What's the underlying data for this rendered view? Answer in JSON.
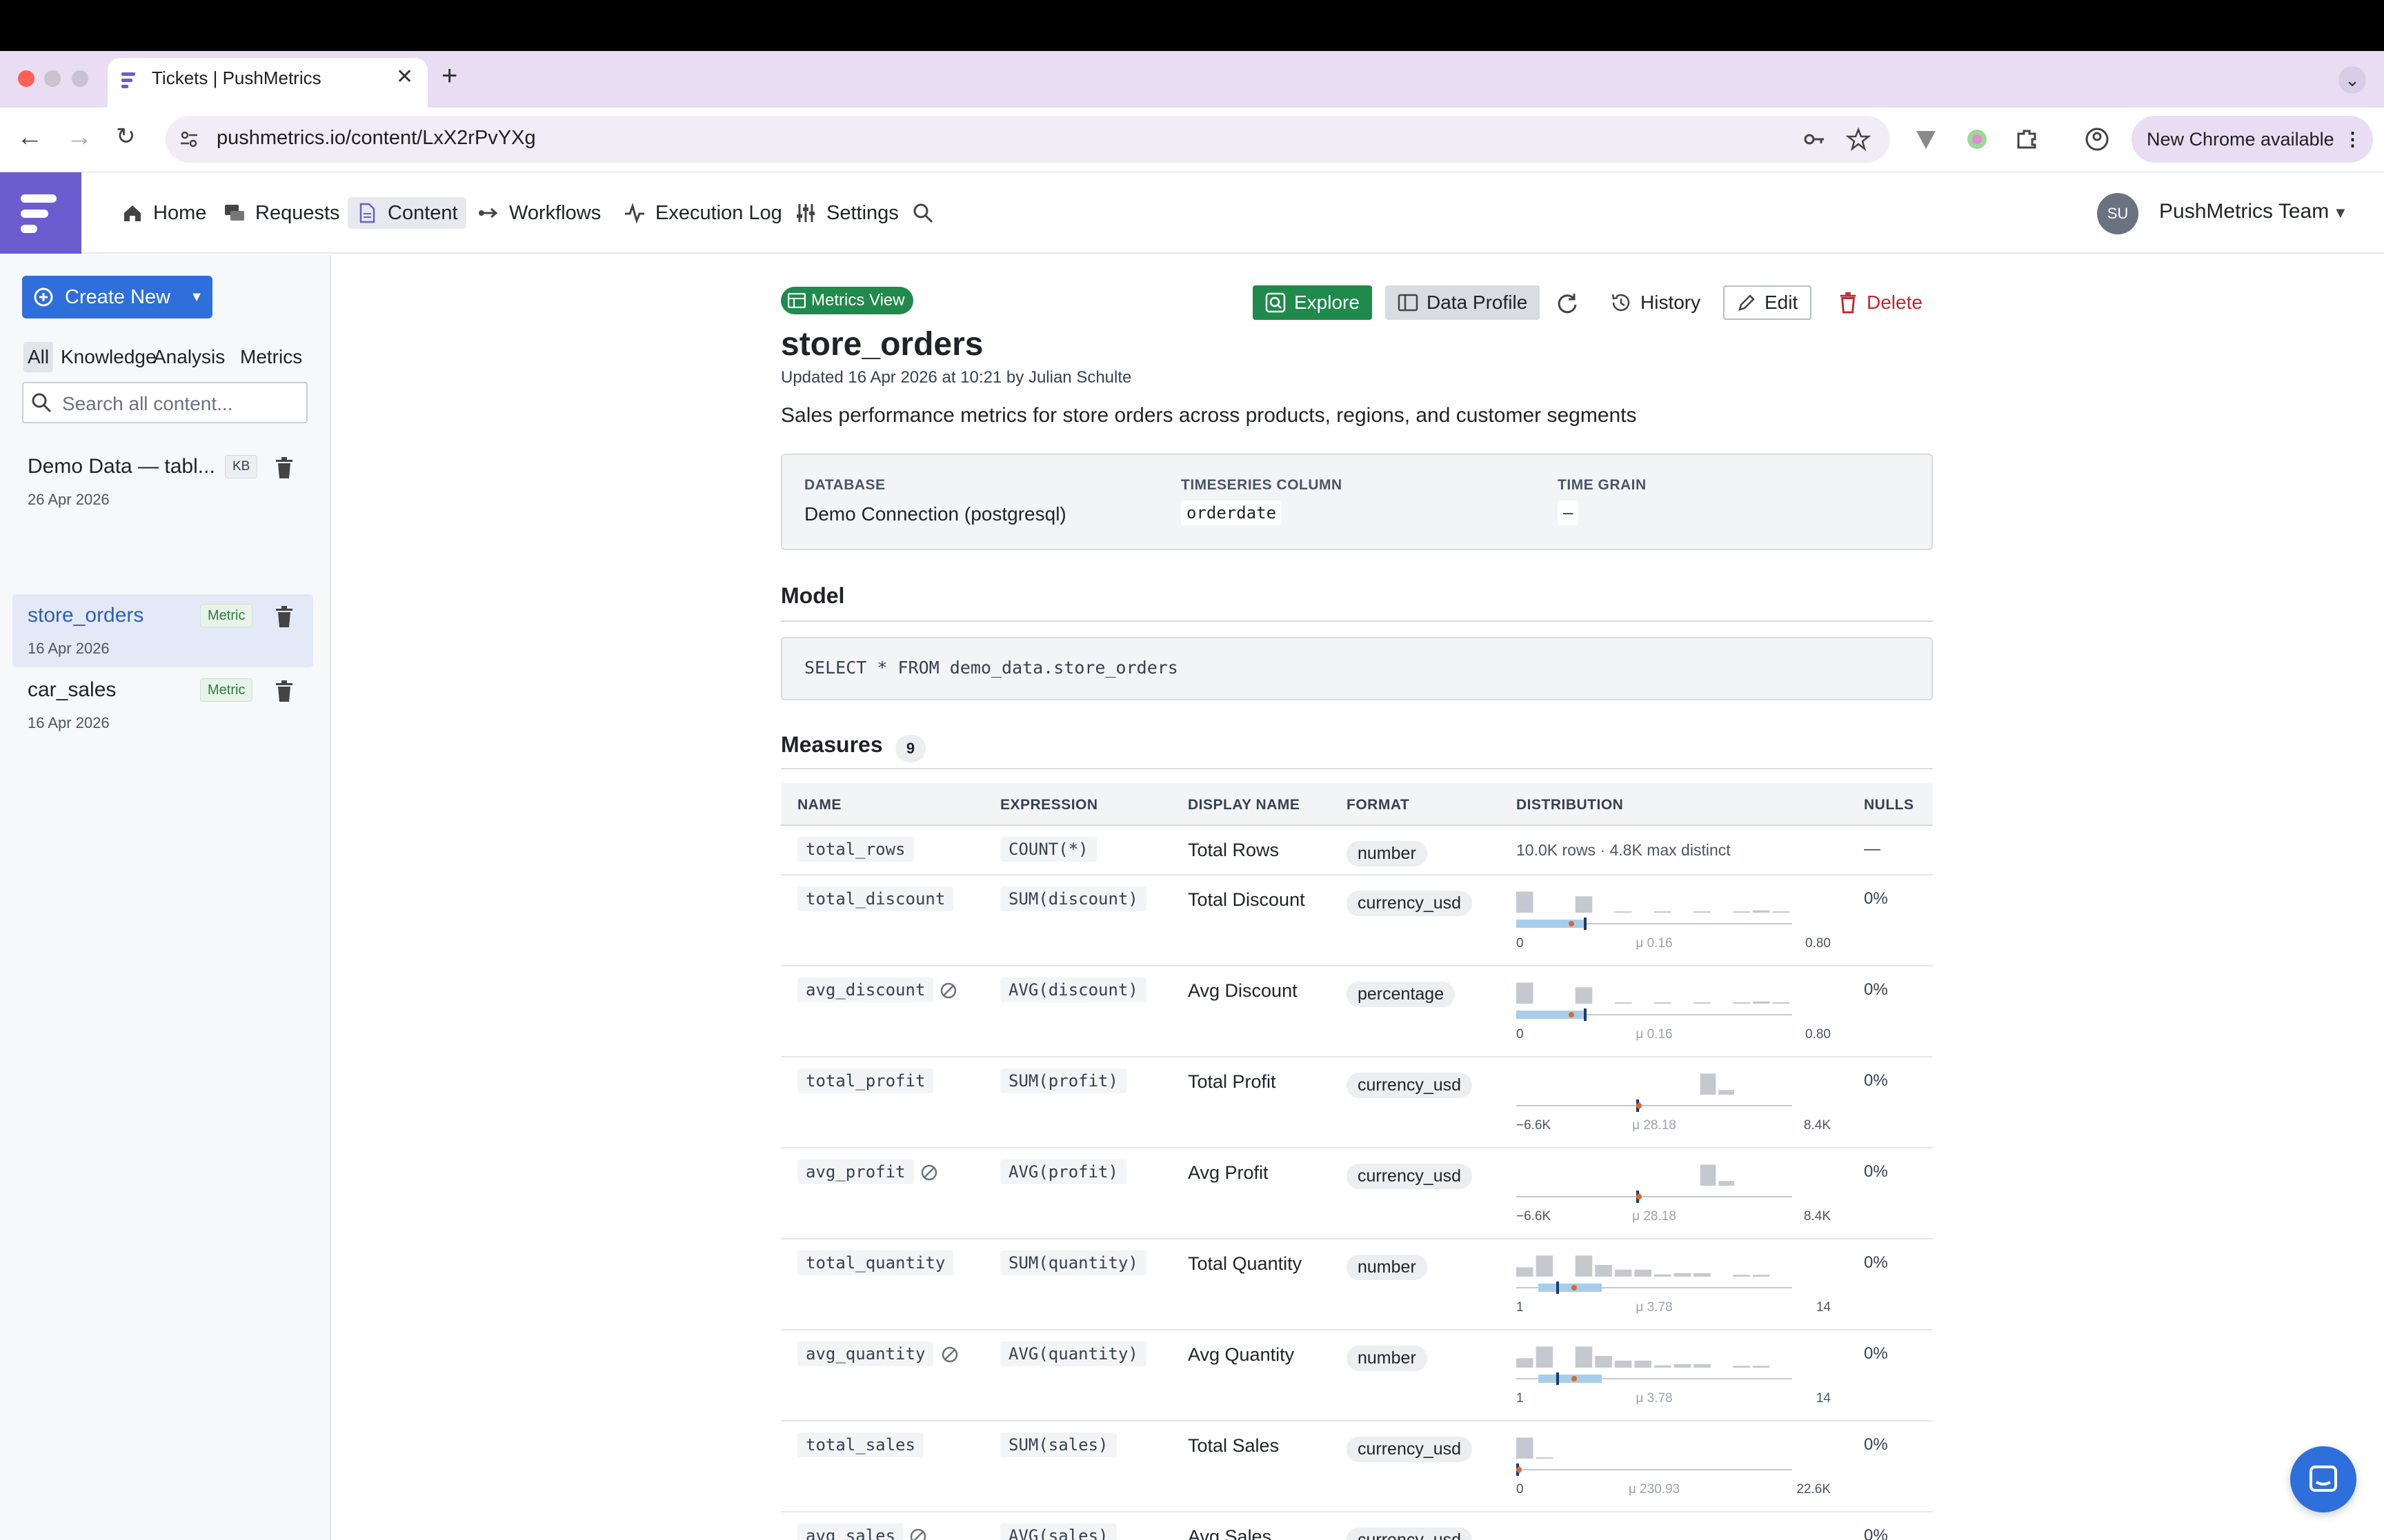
{
  "browser": {
    "tab_title": "Tickets | PushMetrics",
    "url": "pushmetrics.io/content/LxX2rPvYXg",
    "update_label": "New Chrome available"
  },
  "nav": {
    "items": [
      "Home",
      "Requests",
      "Content",
      "Workflows",
      "Execution Log",
      "Settings"
    ],
    "active": "Content",
    "avatar_initials": "SU",
    "team_name": "PushMetrics Team"
  },
  "sidebar": {
    "create_label": "Create New",
    "filters": [
      "All",
      "Knowledge",
      "Analysis",
      "Metrics"
    ],
    "active_filter": "All",
    "search_placeholder": "Search all content...",
    "items": [
      {
        "name": "Demo Data — tabl...",
        "badge": "KB",
        "date": "26 Apr 2026"
      },
      {
        "name": "store_orders",
        "badge": "Metric",
        "date": "16 Apr 2026"
      },
      {
        "name": "car_sales",
        "badge": "Metric",
        "date": "16 Apr 2026"
      }
    ]
  },
  "main": {
    "view_badge": "Metrics View",
    "actions": {
      "explore": "Explore",
      "profile": "Data Profile",
      "history": "History",
      "edit": "Edit",
      "delete": "Delete"
    },
    "title": "store_orders",
    "updated": "Updated 16 Apr 2026 at 10:21 by Julian Schulte",
    "description": "Sales performance metrics for store orders across products, regions, and customer segments",
    "info": {
      "database_label": "DATABASE",
      "database_value": "Demo Connection (postgresql)",
      "ts_label": "TIMESERIES COLUMN",
      "ts_value": "orderdate",
      "grain_label": "TIME GRAIN",
      "grain_value": "—"
    },
    "model_title": "Model",
    "model_sql": "SELECT * FROM demo_data.store_orders",
    "measures_title": "Measures",
    "measures_count": "9",
    "columns": [
      "NAME",
      "EXPRESSION",
      "DISPLAY NAME",
      "FORMAT",
      "DISTRIBUTION",
      "NULLS"
    ],
    "rows": [
      {
        "name": "total_rows",
        "expr": "COUNT(*)",
        "display": "Total Rows",
        "format": "number",
        "dist_note": "10.0K rows · 4.8K max distinct",
        "nulls": "—"
      },
      {
        "name": "total_discount",
        "expr": "SUM(discount)",
        "display": "Total Discount",
        "format": "currency_usd",
        "dist": {
          "min": "0",
          "mean": "μ 0.16",
          "max": "0.80"
        },
        "nulls": "0%"
      },
      {
        "name": "avg_discount",
        "expr": "AVG(discount)",
        "display": "Avg Discount",
        "format": "percentage",
        "dist": {
          "min": "0",
          "mean": "μ 0.16",
          "max": "0.80"
        },
        "nulls": "0%"
      },
      {
        "name": "total_profit",
        "expr": "SUM(profit)",
        "display": "Total Profit",
        "format": "currency_usd",
        "dist": {
          "min": "−6.6K",
          "mean": "μ 28.18",
          "max": "8.4K"
        },
        "nulls": "0%"
      },
      {
        "name": "avg_profit",
        "expr": "AVG(profit)",
        "display": "Avg Profit",
        "format": "currency_usd",
        "dist": {
          "min": "−6.6K",
          "mean": "μ 28.18",
          "max": "8.4K"
        },
        "nulls": "0%"
      },
      {
        "name": "total_quantity",
        "expr": "SUM(quantity)",
        "display": "Total Quantity",
        "format": "number",
        "dist": {
          "min": "1",
          "mean": "μ 3.78",
          "max": "14"
        },
        "nulls": "0%"
      },
      {
        "name": "avg_quantity",
        "expr": "AVG(quantity)",
        "display": "Avg Quantity",
        "format": "number",
        "dist": {
          "min": "1",
          "mean": "μ 3.78",
          "max": "14"
        },
        "nulls": "0%"
      },
      {
        "name": "total_sales",
        "expr": "SUM(sales)",
        "display": "Total Sales",
        "format": "currency_usd",
        "dist": {
          "min": "0",
          "mean": "μ 230.93",
          "max": "22.6K"
        },
        "nulls": "0%"
      },
      {
        "name": "avg_sales",
        "expr": "AVG(sales)",
        "display": "Avg Sales",
        "format": "currency_usd",
        "nulls": "0%"
      }
    ]
  },
  "colors": {
    "brand": "#6d5bd0",
    "primary": "#2f6fdb",
    "success": "#1f8a4c",
    "danger": "#c0262d",
    "histogram_bar": "#c5c9cf",
    "box": "#a8cdeb",
    "mean_marker": "#e0662a"
  }
}
